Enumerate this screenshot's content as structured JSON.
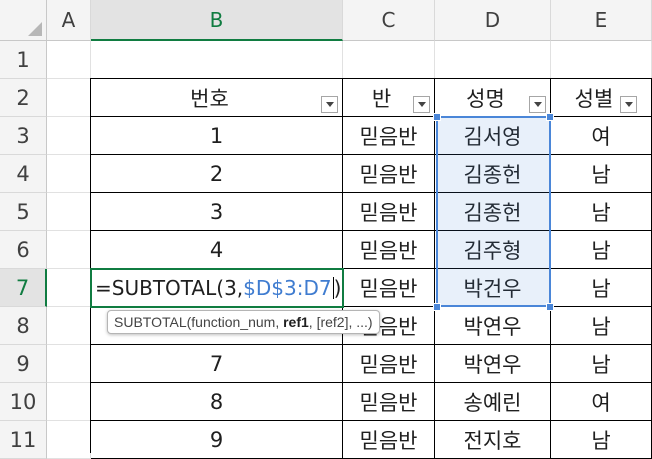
{
  "columns": [
    "A",
    "B",
    "C",
    "D",
    "E"
  ],
  "active_column": "B",
  "rows": [
    "1",
    "2",
    "3",
    "4",
    "5",
    "6",
    "7",
    "8",
    "9",
    "10",
    "11"
  ],
  "active_row": "7",
  "table": {
    "headers": [
      "번호",
      "반",
      "성명",
      "성별"
    ],
    "rows": [
      {
        "no": "1",
        "ban": "믿음반",
        "name": "김서영",
        "gender": "여"
      },
      {
        "no": "2",
        "ban": "믿음반",
        "name": "김종헌",
        "gender": "남"
      },
      {
        "no": "3",
        "ban": "믿음반",
        "name": "김종헌",
        "gender": "남"
      },
      {
        "no": "4",
        "ban": "믿음반",
        "name": "김주형",
        "gender": "남"
      },
      {
        "no": "",
        "ban": "믿음반",
        "name": "박건우",
        "gender": "남"
      },
      {
        "no": "",
        "ban": "믿음반",
        "name": "박연우",
        "gender": "남"
      },
      {
        "no": "7",
        "ban": "믿음반",
        "name": "박연우",
        "gender": "남"
      },
      {
        "no": "8",
        "ban": "믿음반",
        "name": "송예린",
        "gender": "여"
      },
      {
        "no": "9",
        "ban": "믿음반",
        "name": "전지호",
        "gender": "남"
      }
    ]
  },
  "editing": {
    "cell": "B7",
    "formula_prefix": "=SUBTOTAL(3,",
    "formula_ref": "$D$3:D7",
    "formula_suffix": ")"
  },
  "tooltip": {
    "func": "SUBTOTAL(function_num, ",
    "bold_arg": "ref1",
    "rest": ", [ref2], ...)"
  },
  "colors": {
    "accent_green": "#107c41",
    "range_blue": "#4a86d8",
    "range_fill": "rgba(69,128,214,0.12)"
  }
}
